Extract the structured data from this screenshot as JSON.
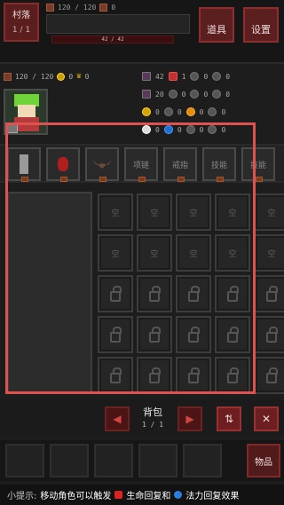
{
  "top": {
    "village_label": "村落",
    "village_level": "1 / 1",
    "hp_text": "120 / 120",
    "hp_extra": "0",
    "xp_text": "42 / 42",
    "equip_label": "道具",
    "settings_label": "设置"
  },
  "stats": {
    "hp": "120 / 120",
    "gold": "0",
    "crowns": "0",
    "atk": "42",
    "atk2": "1",
    "def": "0",
    "mag": "20",
    "res": "0",
    "spd": "0",
    "crit": "0",
    "luck": "0"
  },
  "equipment_slots": [
    {
      "label": "",
      "icon": "axe-icon"
    },
    {
      "label": "",
      "icon": "gem-icon"
    },
    {
      "label": "",
      "icon": "bat-icon"
    },
    {
      "label": "项链"
    },
    {
      "label": "戒指"
    },
    {
      "label": "技能"
    },
    {
      "label": "技能"
    }
  ],
  "grid": {
    "empty_label": "空",
    "rows": [
      [
        "空",
        "空",
        "空",
        "空",
        "空"
      ],
      [
        "空",
        "空",
        "空",
        "空",
        "空"
      ],
      [
        "lock",
        "lock",
        "lock",
        "lock",
        "lock"
      ],
      [
        "lock",
        "lock",
        "lock",
        "lock",
        "lock"
      ],
      [
        "lock",
        "lock",
        "lock",
        "lock",
        "lock"
      ]
    ]
  },
  "pager": {
    "bag_label": "背包",
    "page": "1 / 1",
    "prev": "◀",
    "next": "▶",
    "sort": "⇅",
    "close": "✕"
  },
  "bottom_tabs": [
    "",
    "",
    "",
    "",
    "",
    "",
    "物品"
  ],
  "tip": {
    "prefix": "小提示:",
    "text1": "移动角色可以触发",
    "text2": "生命回复和",
    "text3": "法力回复效果"
  },
  "colors": {
    "accent_red": "#8a2b2b",
    "highlight": "#e0524e"
  }
}
